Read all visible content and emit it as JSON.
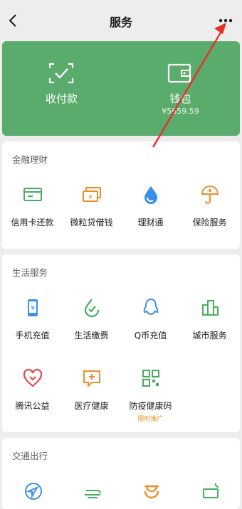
{
  "nav": {
    "title": "服务"
  },
  "hero": {
    "pay": {
      "label": "收付款"
    },
    "wallet": {
      "label": "钱包",
      "balance": "¥5659.59"
    },
    "bg_color": "#5aac6c"
  },
  "finance": {
    "title": "金融理财",
    "items": [
      {
        "label": "信用卡还款",
        "icon": "credit-card-icon"
      },
      {
        "label": "微粒贷借钱",
        "icon": "loan-icon"
      },
      {
        "label": "理财通",
        "icon": "wealth-drop-icon"
      },
      {
        "label": "保险服务",
        "icon": "insurance-icon"
      }
    ]
  },
  "life": {
    "title": "生活服务",
    "items": [
      {
        "label": "手机充值",
        "icon": "phone-icon"
      },
      {
        "label": "生活缴费",
        "icon": "bill-check-icon"
      },
      {
        "label": "Q币充值",
        "icon": "qq-penguin-icon"
      },
      {
        "label": "城市服务",
        "icon": "city-building-icon"
      },
      {
        "label": "腾讯公益",
        "icon": "charity-heart-icon"
      },
      {
        "label": "医疗健康",
        "icon": "medical-box-icon"
      },
      {
        "label": "防疫健康码",
        "icon": "health-qr-icon",
        "tag": "限时推广"
      }
    ]
  },
  "transport": {
    "title": "交通出行"
  },
  "colors": {
    "accent_green": "#5aac6c",
    "orange": "#f08d2a",
    "blue": "#3a8fe8",
    "red": "#e04a4a",
    "annotation_red": "#e8302a"
  }
}
